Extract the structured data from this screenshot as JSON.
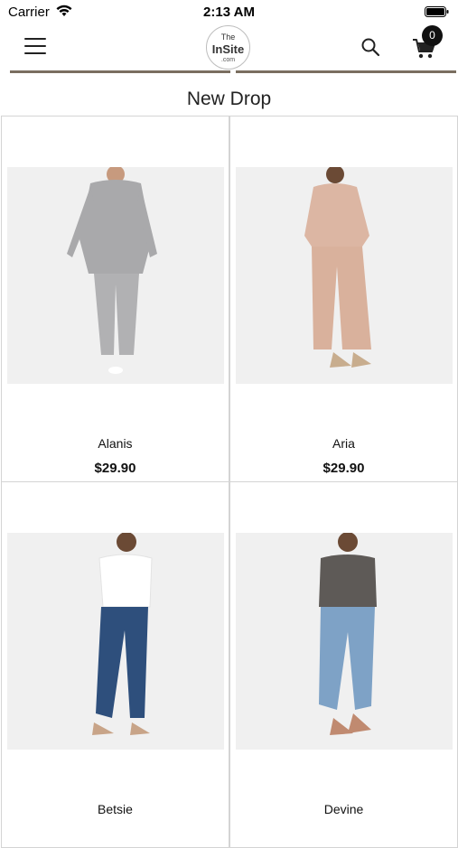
{
  "status_bar": {
    "carrier": "Carrier",
    "time": "2:13 AM"
  },
  "header": {
    "logo": {
      "line1": "The",
      "line2": "InSite",
      "line3": ".com"
    },
    "cart_count": "0",
    "icons": {
      "menu": "hamburger-icon",
      "search": "search-icon",
      "cart": "cart-icon"
    }
  },
  "page": {
    "title": "New Drop"
  },
  "products": [
    {
      "name": "Alanis",
      "price": "$29.90",
      "outfit_color": "#a9a9ab"
    },
    {
      "name": "Aria",
      "price": "$29.90",
      "outfit_color": "#dcb6a3"
    },
    {
      "name": "Betsie",
      "price": "",
      "outfit_color": "#2e4f7c"
    },
    {
      "name": "Devine",
      "price": "",
      "outfit_color": "#5e5a57"
    }
  ]
}
